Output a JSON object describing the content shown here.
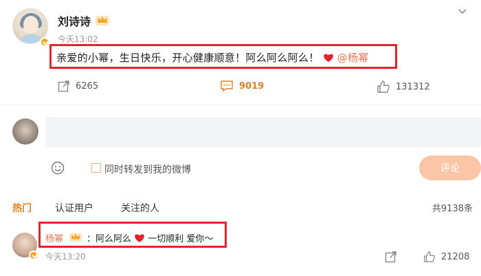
{
  "post": {
    "author": "刘诗诗",
    "timestamp": "今天13:02",
    "text_before": "亲爱的小幂，生日快乐，开心健康顺意！阿么阿么阿么！",
    "mention": "@杨幂",
    "actions": {
      "repost_count": "6265",
      "comment_count": "9019",
      "like_count": "131312"
    }
  },
  "composer": {
    "input_value": "",
    "repost_label": "同时转发到我的微博",
    "submit_label": "评论"
  },
  "tabs": [
    {
      "label": "热门",
      "active": true
    },
    {
      "label": "认证用户",
      "active": false
    },
    {
      "label": "关注的人",
      "active": false
    }
  ],
  "total_comments": "共9138条",
  "reply": {
    "author": "杨幂",
    "text_before": "：阿么阿么",
    "text_after": "一切顺利 爱你～",
    "timestamp": "今天13:20",
    "like_count": "21208"
  },
  "colors": {
    "accent": "#e67e22",
    "highlight_border": "#e5212b",
    "heart": "#e5212b",
    "mention": "#eb7350",
    "submit_disabled": "#fbc6a8"
  },
  "icons": [
    "more-chevron-icon",
    "verified-badge-icon",
    "crown-icon",
    "heart-icon",
    "repost-icon",
    "comment-icon",
    "like-icon",
    "emoji-icon"
  ]
}
